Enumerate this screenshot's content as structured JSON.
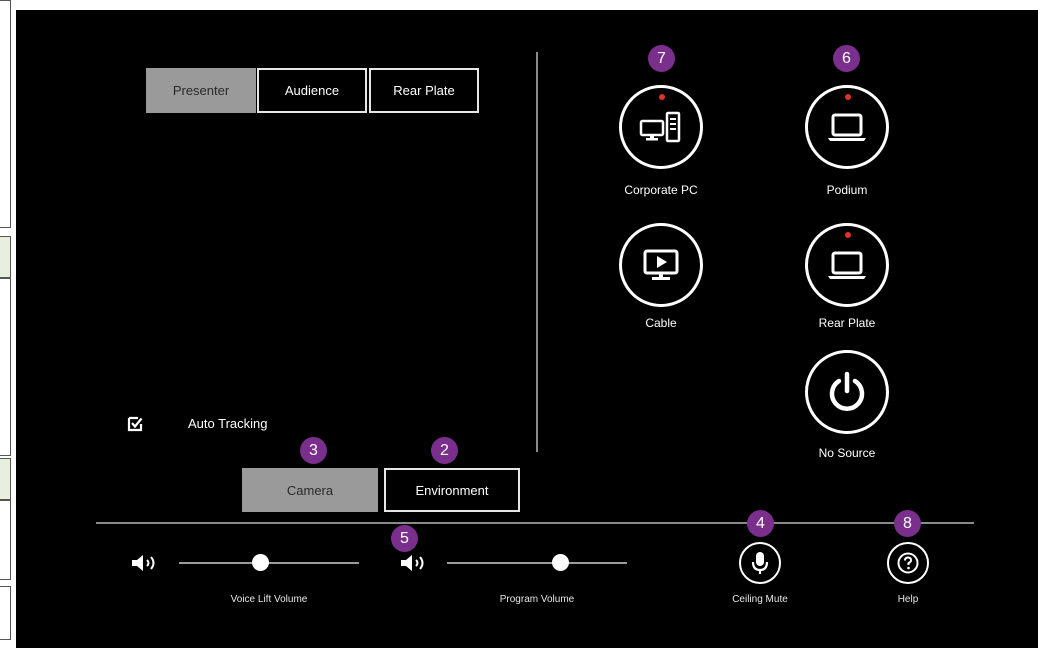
{
  "tabs": [
    {
      "label": "Presenter",
      "active": true
    },
    {
      "label": "Audience",
      "active": false
    },
    {
      "label": "Rear Plate",
      "active": false
    }
  ],
  "auto_tracking": {
    "label": "Auto Tracking",
    "checked": true
  },
  "mode_buttons": [
    {
      "label": "Camera",
      "active": true,
      "badge": "3"
    },
    {
      "label": "Environment",
      "active": false,
      "badge": "2"
    }
  ],
  "sources": [
    {
      "label": "Corporate PC",
      "icon": "desktop-pc-icon",
      "badge": "7",
      "status_dot": true
    },
    {
      "label": "Podium",
      "icon": "laptop-icon",
      "badge": "6",
      "status_dot": true
    },
    {
      "label": "Cable",
      "icon": "tv-play-icon",
      "status_dot": false
    },
    {
      "label": "Rear Plate",
      "icon": "laptop-icon",
      "status_dot": true
    },
    {
      "label": "No Source",
      "icon": "power-icon",
      "status_dot": false
    }
  ],
  "audio": {
    "voice_lift": {
      "label": "Voice Lift Volume",
      "level": 0.45
    },
    "program": {
      "label": "Program Volume",
      "level": 0.63,
      "badge": "5"
    },
    "ceiling_mute": {
      "label": "Ceiling Mute",
      "badge": "4"
    },
    "help": {
      "label": "Help",
      "badge": "8"
    }
  },
  "colors": {
    "background": "#000000",
    "active_button": "#9a9a9a",
    "badge": "#7b2f8c",
    "status_dot": "#e0312a"
  }
}
